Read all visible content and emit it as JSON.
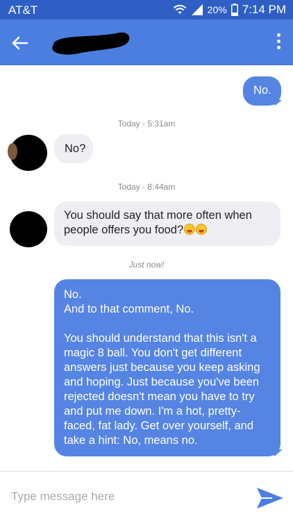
{
  "status_bar": {
    "carrier": "AT&T",
    "battery": "20%",
    "time": "7:14 PM",
    "icons": [
      "wifi-icon",
      "signal-icon",
      "battery-icon"
    ]
  },
  "header": {
    "back_icon": "back-arrow-icon",
    "contact_name": "",
    "menu_icon": "overflow-menu-icon"
  },
  "messages": [
    {
      "direction": "outgoing",
      "lines": [
        "No."
      ]
    },
    {
      "type": "timestamp",
      "text": "Today - 5:31am"
    },
    {
      "direction": "incoming",
      "lines": [
        "No?"
      ]
    },
    {
      "type": "timestamp",
      "text": "Today - 8:44am"
    },
    {
      "direction": "incoming",
      "lines": [
        "You should say that more often when",
        "people offers you food?"
      ],
      "emoji": [
        "laughing-emoji",
        "laughing-emoji"
      ]
    },
    {
      "type": "timestamp",
      "text": "Just now!"
    },
    {
      "direction": "outgoing",
      "lines": [
        "No.",
        "And to that comment, No.",
        "",
        "You should understand that this isn't a",
        "magic 8 ball. You don't get different",
        "answers just because you keep asking",
        "and hoping. Just because you've been",
        "rejected doesn't mean you have to try",
        "and put me down. I'm a hot, pretty-",
        "faced, fat lady. Get over yourself, and",
        "take a hint: No, means no."
      ]
    }
  ],
  "composer": {
    "placeholder": "Type message here",
    "send_icon": "send-icon"
  },
  "colors": {
    "status_bar": "#2f5fc4",
    "header": "#4c7ee0",
    "outgoing_bubble": "#5584e3",
    "incoming_bubble": "#efeff3",
    "send_icon": "#4c7ee0"
  }
}
